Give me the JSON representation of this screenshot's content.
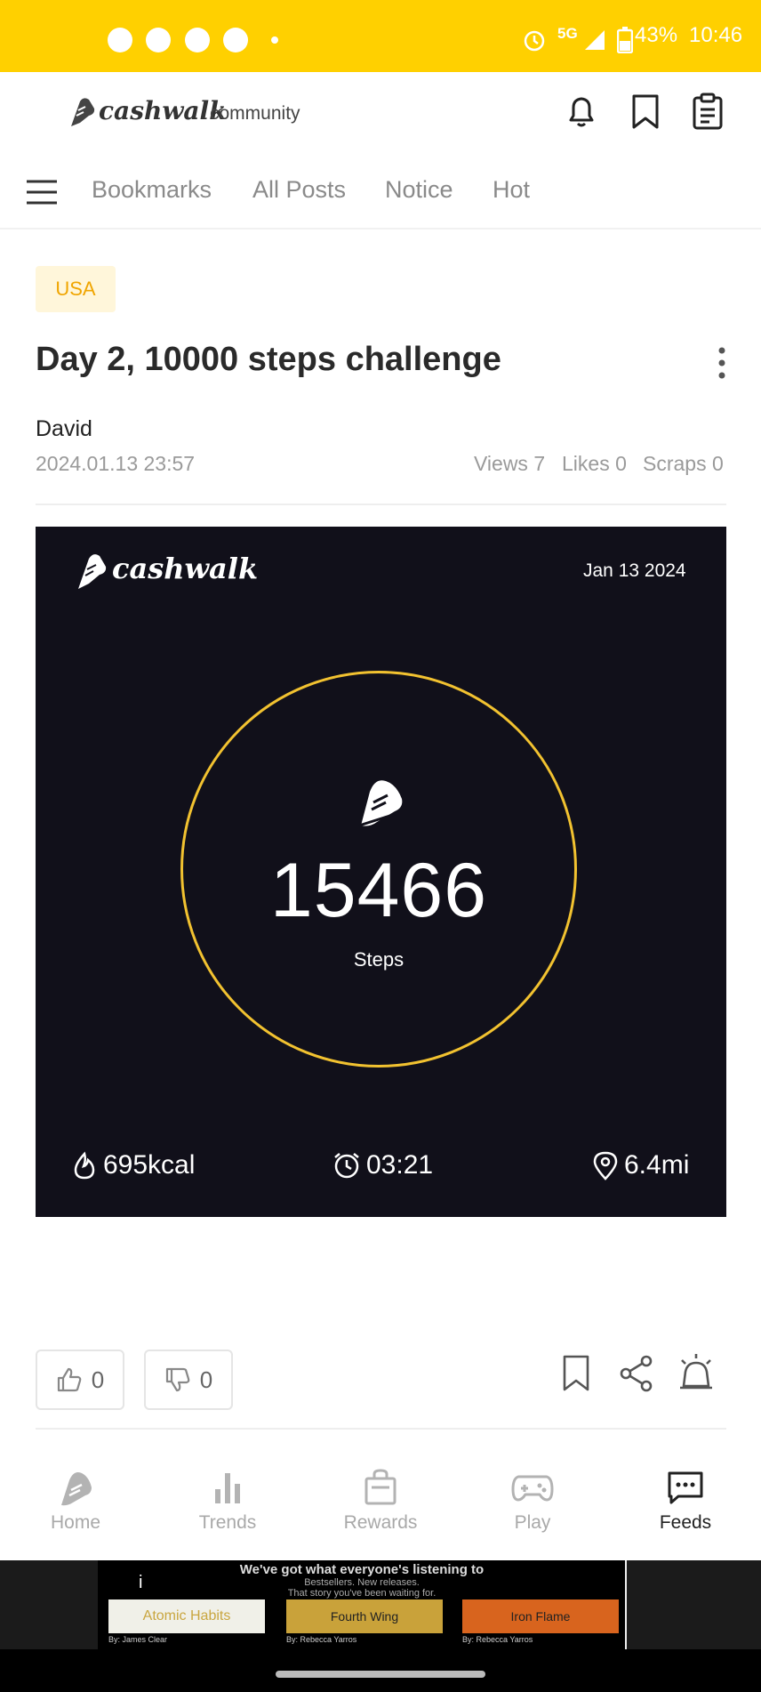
{
  "status_bar": {
    "battery": "43%",
    "time": "10:46",
    "network": "5G",
    "notification_icons": [
      "messenger-icon",
      "facebook-icon",
      "facebook-icon",
      "facebook-icon"
    ],
    "bg_color": "#FFD000"
  },
  "header": {
    "brand": "cashwalk",
    "brand_suffix": "community",
    "icons": [
      "bell-icon",
      "bookmark-icon",
      "clipboard-icon"
    ]
  },
  "nav": {
    "tabs": [
      "Bookmarks",
      "All Posts",
      "Notice",
      "Hot"
    ]
  },
  "post": {
    "category": "USA",
    "title": "Day 2, 10000 steps challenge",
    "author": "David",
    "date": "2024.01.13 23:57",
    "views_label": "Views 7",
    "likes_label": "Likes 0",
    "scraps_label": "Scraps 0"
  },
  "card": {
    "brand": "cashwalk",
    "date": "Jan 13 2024",
    "steps": "15466",
    "steps_label": "Steps",
    "calories": "695kcal",
    "duration": "03:21",
    "distance": "6.4mi",
    "ring_color": "#F2C230"
  },
  "actions": {
    "like_count": "0",
    "dislike_count": "0"
  },
  "bottom_nav": {
    "items": [
      {
        "label": "Home",
        "icon": "shoe-icon"
      },
      {
        "label": "Trends",
        "icon": "bar-chart-icon"
      },
      {
        "label": "Rewards",
        "icon": "shopping-bag-icon"
      },
      {
        "label": "Play",
        "icon": "gamepad-icon"
      },
      {
        "label": "Feeds",
        "icon": "chat-icon"
      }
    ],
    "active": "Feeds"
  },
  "ad": {
    "headline": "We've got what everyone's listening to",
    "subline": "Bestsellers. New releases.",
    "tagline": "That story you've been waiting for.",
    "books": [
      {
        "title": "Atomic Habits",
        "author": "By: James Clear"
      },
      {
        "title": "Fourth Wing",
        "author": "By: Rebecca Yarros"
      },
      {
        "title": "Iron Flame",
        "author": "By: Rebecca Yarros"
      }
    ]
  }
}
